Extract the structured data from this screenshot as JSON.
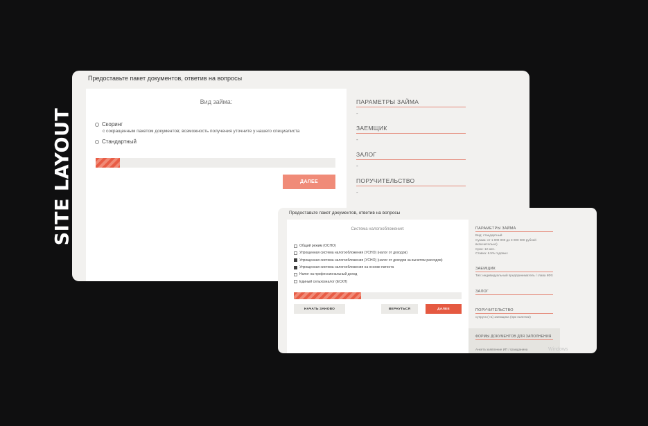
{
  "side_title": "SITE LAYOUT",
  "window1": {
    "title": "Предоставьте пакет документов, ответив на вопросы",
    "section_title": "Вид займа:",
    "options": [
      {
        "label": "Скоринг",
        "sub": "с сокращенным пакетом документов; возможность получения уточните у нашего специалиста"
      },
      {
        "label": "Стандартный",
        "sub": ""
      }
    ],
    "progress": 0.1,
    "next_label": "ДАЛЕЕ",
    "sidebar": [
      {
        "heading": "ПАРАМЕТРЫ ЗАЙМА",
        "value": "-"
      },
      {
        "heading": "ЗАЕМЩИК",
        "value": "-"
      },
      {
        "heading": "ЗАЛОГ",
        "value": "-"
      },
      {
        "heading": "ПОРУЧИТЕЛЬСТВО",
        "value": "-"
      }
    ]
  },
  "window2": {
    "title": "Предоставьте пакет документов, ответив на вопросы",
    "section_title": "Система налогообложения:",
    "items": [
      {
        "label": "Общий режим (ОСНО)",
        "checked": false
      },
      {
        "label": "Упрощенная система налогообложения (УСНО) (налог от доходов)",
        "checked": false
      },
      {
        "label": "Упрощенная система налогообложения (УСНО) (налог от доходов за вычетом расходов)",
        "checked": true
      },
      {
        "label": "Упрощенная система налогообложения на основе патента",
        "checked": true
      },
      {
        "label": "Налог на профессиональный доход",
        "checked": false
      },
      {
        "label": "Единый сельхозналог (ЕСХН)",
        "checked": false
      }
    ],
    "progress": 0.4,
    "buttons": {
      "restart": "НАЧАТЬ ЗАНОВО",
      "back": "ВЕРНУТЬСЯ",
      "next": "ДАЛЕЕ"
    },
    "sidebar": {
      "params_heading": "ПАРАМЕТРЫ ЗАЙМА",
      "params_lines": [
        "Вид: стандартный",
        "Сумма: от 1 000 000 до 3 000 000 рублей включительно)",
        "Срок: 12 мес.",
        "Ставка: 6.5% годовых"
      ],
      "borrower_heading": "ЗАЕМЩИК",
      "borrower_value": "Тип: индивидуальный предприниматель / глава КФХ",
      "collateral_heading": "ЗАЛОГ",
      "guarantee_heading": "ПОРУЧИТЕЛЬСТВО",
      "guarantee_value": "супруга (-га) заемщика (при наличии)",
      "forms_heading": "ФОРМЫ ДОКУМЕНТОВ ДЛЯ ЗАПОЛНЕНИЯ",
      "forms_value": "Анкета заявление ИП / гражданина"
    },
    "watermark": "Windows"
  },
  "colors": {
    "accent": "#e55941",
    "accent_light": "#f08b78",
    "background": "#0f0f10",
    "panel": "#f2f1ef"
  }
}
